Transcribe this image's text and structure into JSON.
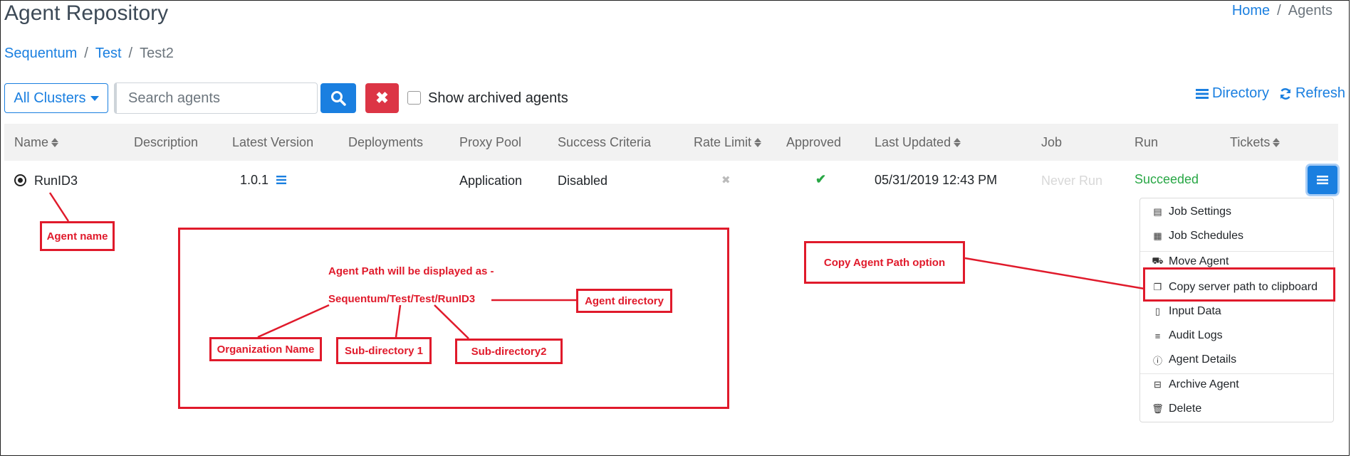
{
  "page": {
    "title": "Agent Repository"
  },
  "top_breadcrumb": {
    "home": "Home",
    "sep": "/",
    "current": "Agents"
  },
  "breadcrumb": {
    "items": [
      "Sequentum",
      "Test",
      "Test2"
    ],
    "sep": "/"
  },
  "toolbar": {
    "clusters_label": "All Clusters",
    "search_placeholder": "Search agents",
    "search_value": "",
    "clear_symbol": "✖",
    "show_archived_label": "Show archived agents",
    "show_archived_checked": false,
    "directory_label": "Directory",
    "refresh_label": "Refresh"
  },
  "table": {
    "headers": [
      "Name",
      "Description",
      "Latest Version",
      "Deployments",
      "Proxy Pool",
      "Success Criteria",
      "Rate Limit",
      "Approved",
      "Last Updated",
      "Job",
      "Run",
      "Tickets"
    ],
    "row": {
      "name": "RunID3",
      "description": "",
      "version": "1.0.1",
      "deployments": "",
      "proxy_pool": "Application",
      "success_criteria": "Disabled",
      "rate_limit": "✖",
      "approved": "✔",
      "last_updated": "05/31/2019 12:43 PM",
      "job": "Never Run",
      "run": "Succeeded",
      "tickets": ""
    }
  },
  "dropdown": {
    "items": [
      "Job Settings",
      "Job Schedules",
      "Move Agent",
      "Copy server path to clipboard",
      "Input Data",
      "Audit Logs",
      "Agent Details",
      "Archive Agent",
      "Delete"
    ]
  },
  "annotations": {
    "agent_name": "Agent name",
    "path_intro": "Agent Path will be displayed as -",
    "path_value": "Sequentum/Test/Test/RunID3",
    "org_name": "Organization Name",
    "sub1": "Sub-directory 1",
    "sub2": "Sub-directory2",
    "agent_dir": "Agent directory",
    "copy_option": "Copy Agent Path option"
  },
  "colors": {
    "primary": "#1a7fe0",
    "danger": "#dc3545",
    "success": "#28a745",
    "annotation_red": "#e01a2b"
  }
}
